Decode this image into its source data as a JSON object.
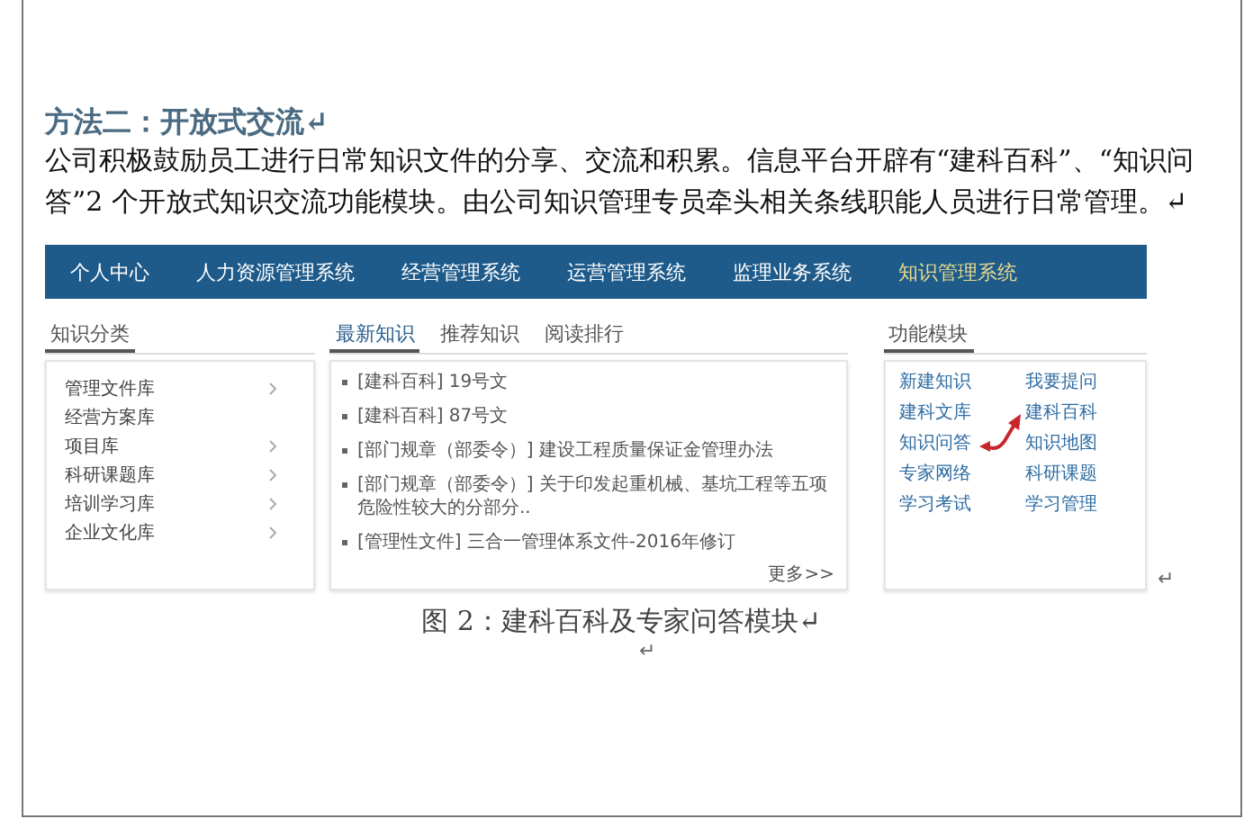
{
  "document": {
    "heading": "方法二：开放式交流↵",
    "paragraph": "公司积极鼓励员工进行日常知识文件的分享、交流和积累。信息平台开辟有“建科百科”、“知识问答”2 个开放式知识交流功能模块。由公司知识管理专员牵头相关条线职能人员进行日常管理。↵",
    "image_mark": "↵",
    "caption": "图 2：建科百科及专家问答模块↵",
    "trailing_mark": "↵"
  },
  "app": {
    "nav": [
      {
        "label": "个人中心",
        "selected": false
      },
      {
        "label": "人力资源管理系统",
        "selected": false
      },
      {
        "label": "经营管理系统",
        "selected": false
      },
      {
        "label": "运营管理系统",
        "selected": false
      },
      {
        "label": "监理业务系统",
        "selected": false
      },
      {
        "label": "知识管理系统",
        "selected": true
      }
    ],
    "category_panel": {
      "title": "知识分类",
      "items": [
        {
          "label": "管理文件库",
          "expandable": true
        },
        {
          "label": "经营方案库",
          "expandable": false
        },
        {
          "label": "项目库",
          "expandable": true
        },
        {
          "label": "科研课题库",
          "expandable": true
        },
        {
          "label": "培训学习库",
          "expandable": true
        },
        {
          "label": "企业文化库",
          "expandable": true
        }
      ]
    },
    "news_panel": {
      "tabs": [
        {
          "label": "最新知识",
          "selected": true
        },
        {
          "label": "推荐知识",
          "selected": false
        },
        {
          "label": "阅读排行",
          "selected": false
        }
      ],
      "items": [
        "[建科百科] 19号文",
        "[建科百科] 87号文",
        "[部门规章（部委令）] 建设工程质量保证金管理办法",
        "[部门规章（部委令）] 关于印发起重机械、基坑工程等五项危险性较大的分部分..",
        "[管理性文件] 三合一管理体系文件-2016年修订"
      ],
      "more": "更多>>"
    },
    "function_panel": {
      "title": "功能模块",
      "links": [
        "新建知识",
        "我要提问",
        "建科文库",
        "建科百科",
        "知识问答",
        "知识地图",
        "专家网络",
        "科研课题",
        "学习考试",
        "学习管理"
      ]
    }
  }
}
